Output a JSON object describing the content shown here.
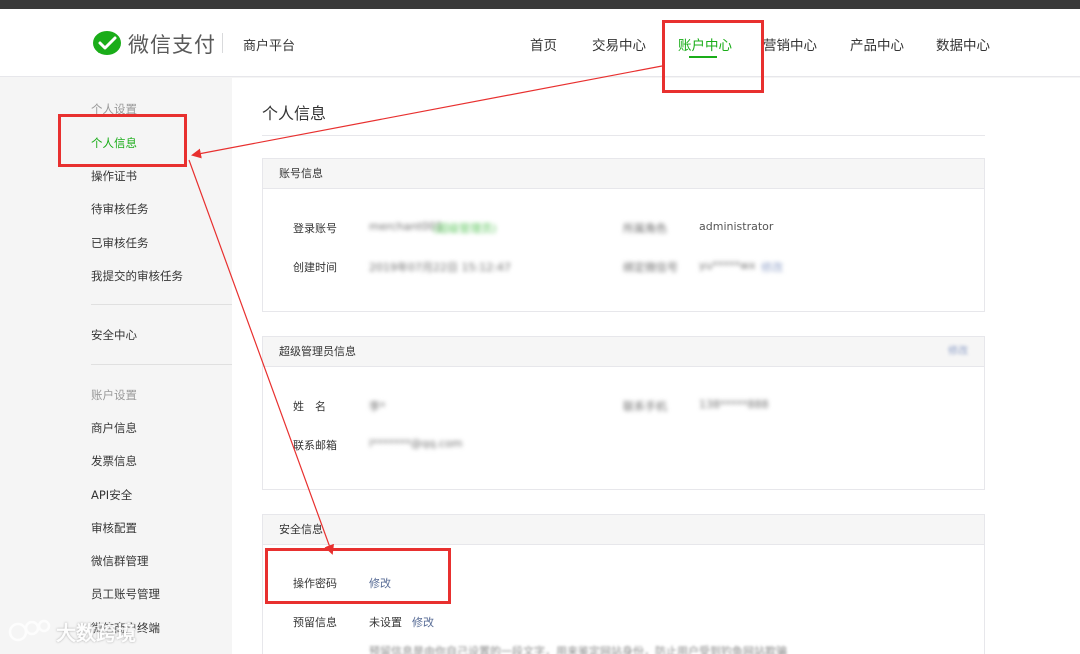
{
  "header": {
    "logo_text": "微信支付",
    "platform": "商户平台",
    "nav": [
      {
        "label": "首页"
      },
      {
        "label": "交易中心"
      },
      {
        "label": "账户中心",
        "active": true
      },
      {
        "label": "营销中心"
      },
      {
        "label": "产品中心"
      },
      {
        "label": "数据中心"
      }
    ]
  },
  "sidebar": {
    "group1": "个人设置",
    "items1": [
      "个人信息",
      "操作证书",
      "待审核任务",
      "已审核任务",
      "我提交的审核任务"
    ],
    "security": "安全中心",
    "group2": "账户设置",
    "items2": [
      "商户信息",
      "发票信息",
      "API安全",
      "审核配置",
      "微信群管理",
      "员工账号管理",
      "微信商户终端"
    ]
  },
  "main": {
    "title": "个人信息",
    "account_panel": {
      "title": "账号信息",
      "login_label": "登录账号",
      "login_value": "merchant001",
      "login_badge": "(超级管理员)",
      "role_label": "所属角色",
      "role_value": "administrator",
      "created_label": "创建时间",
      "created_value": "2019年07月22日 15:12:47",
      "bind_label": "绑定微信号",
      "bind_value": "yu*****wx",
      "bind_link": "修改"
    },
    "admin_panel": {
      "title": "超级管理员信息",
      "action": "修改",
      "name_label": "姓　名",
      "name_value": "李*",
      "phone_label": "联系手机",
      "phone_value": "138*****888",
      "email_label": "联系邮箱",
      "email_value": "l*******@qq.com"
    },
    "security_panel": {
      "title": "安全信息",
      "pwd_label": "操作密码",
      "pwd_link": "修改",
      "reserve_label": "预留信息",
      "reserve_value": "未设置",
      "reserve_link": "修改",
      "reserve_desc": "预留信息是由你自己设置的一段文字，用来鉴定网站身份，防止用户受到钓鱼网站欺骗"
    }
  },
  "watermark": {
    "text": "大数跨境"
  },
  "colors": {
    "brand_green": "#1aad19",
    "link_blue": "#576b95",
    "annotation_red": "#e8302f"
  }
}
